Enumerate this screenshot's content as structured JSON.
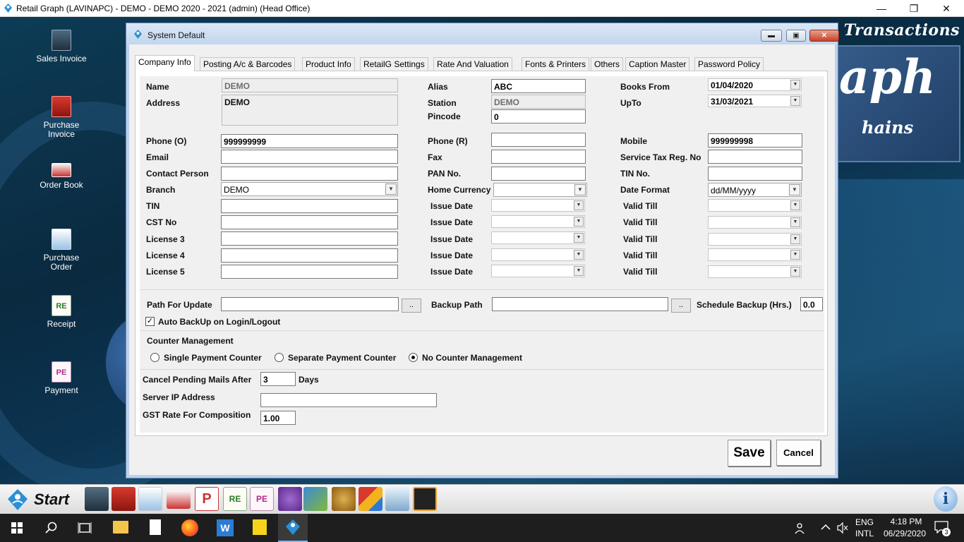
{
  "app": {
    "title": "Retail Graph (LAVINAPC) - DEMO - DEMO  2020 - 2021 (admin) (Head Office)",
    "controls": {
      "minimize": "—",
      "restore": "❐",
      "close": "✕"
    }
  },
  "desktop": {
    "icons": [
      {
        "label": "Sales Invoice"
      },
      {
        "label": "Purchase Invoice"
      },
      {
        "label": "Order Book"
      },
      {
        "label": "Purchase Order"
      },
      {
        "label": "Receipt"
      },
      {
        "label": "Payment"
      }
    ],
    "brand_transactions": "Transactions",
    "brand_big": "aph",
    "brand_small": "hains"
  },
  "dialog": {
    "title": "System Default",
    "controls": {
      "minimize": "▬",
      "restore": "▣",
      "close": "✕"
    },
    "tabs": [
      {
        "label": "Company Info",
        "active": true
      },
      {
        "label": "Posting A/c & Barcodes"
      },
      {
        "label": "Product Info"
      },
      {
        "label": "RetailG Settings"
      },
      {
        "label": "Rate And Valuation"
      },
      {
        "label": "Fonts & Printers"
      },
      {
        "label": "Others"
      },
      {
        "label": "Caption Master"
      },
      {
        "label": "Password Policy"
      }
    ],
    "left": {
      "name_label": "Name",
      "name_value": "DEMO",
      "address_label": "Address",
      "address_value": "DEMO",
      "phone_o_label": "Phone (O)",
      "phone_o_value": "999999999",
      "email_label": "Email",
      "email_value": "",
      "contact_label": "Contact Person",
      "contact_value": "",
      "branch_label": "Branch",
      "branch_value": "DEMO",
      "tin_label": "TIN",
      "cst_label": "CST No",
      "license3_label": "License 3",
      "license4_label": "License 4",
      "license5_label": "License 5"
    },
    "middle": {
      "alias_label": "Alias",
      "alias_value": "ABC",
      "station_label": "Station",
      "station_value": "DEMO",
      "pincode_label": "Pincode",
      "pincode_value": "0",
      "phone_r_label": "Phone (R)",
      "fax_label": "Fax",
      "pan_label": "PAN No.",
      "currency_label": "Home Currency",
      "issue_date_label": "Issue Date"
    },
    "right": {
      "books_from_label": "Books From",
      "books_from_value": "01/04/2020",
      "upto_label": "UpTo",
      "upto_value": "31/03/2021",
      "mobile_label": "Mobile",
      "mobile_value": "999999998",
      "service_tax_label": "Service Tax Reg. No",
      "tin_no_label": "TIN No.",
      "date_format_label": "Date Format",
      "date_format_value": "dd/MM/yyyy",
      "valid_till_label": "Valid Till"
    },
    "paths": {
      "update_label": "Path For Update",
      "backup_label": "Backup Path",
      "browse_label": "..",
      "schedule_label": "Schedule Backup (Hrs.)",
      "schedule_value": "0.0",
      "auto_backup_label": "Auto BackUp on Login/Logout",
      "auto_backup_check": "✓"
    },
    "counter": {
      "group_label": "Counter Management",
      "single": "Single Payment Counter",
      "separate": "Separate Payment Counter",
      "none": "No Counter Management"
    },
    "misc": {
      "cancel_mails_label": "Cancel Pending Mails After",
      "cancel_mails_value": "3",
      "days_label": "Days",
      "server_ip_label": "Server IP Address",
      "gst_label": "GST Rate For Composition",
      "gst_value": "1.00"
    },
    "save_label": "Save",
    "cancel_label": "Cancel"
  },
  "apptaskbar": {
    "start_label": "Start"
  },
  "windows_taskbar": {
    "lang_top": "ENG",
    "lang_bottom": "INTL",
    "time": "4:18 PM",
    "date": "06/29/2020",
    "notification_count": "3"
  }
}
